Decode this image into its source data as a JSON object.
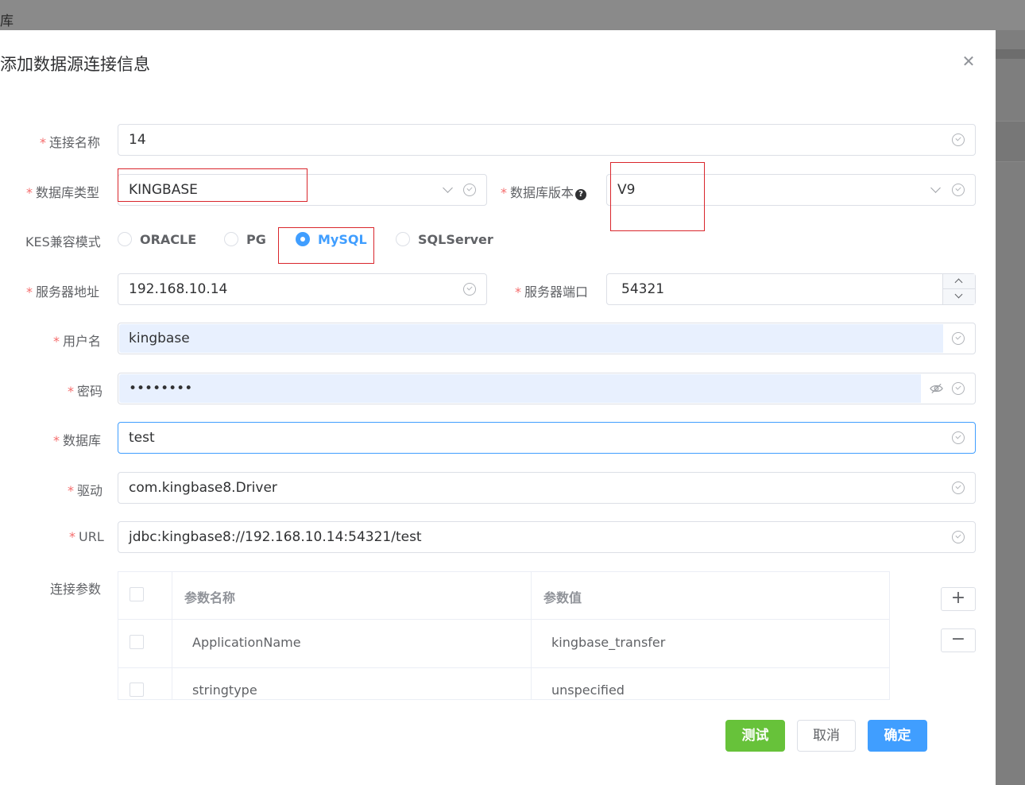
{
  "background": {
    "title": "库"
  },
  "dialog": {
    "title": "添加数据源连接信息",
    "close_icon": "close-icon"
  },
  "form": {
    "connection_name": {
      "label": "连接名称",
      "value": "14"
    },
    "db_type": {
      "label": "数据库类型",
      "value": "KINGBASE"
    },
    "db_version": {
      "label": "数据库版本",
      "value": "V9"
    },
    "kes_mode": {
      "label": "KES兼容模式",
      "options": [
        "ORACLE",
        "PG",
        "MySQL",
        "SQLServer"
      ],
      "selected": "MySQL"
    },
    "server_address": {
      "label": "服务器地址",
      "value": "192.168.10.14"
    },
    "server_port": {
      "label": "服务器端口",
      "value": "54321"
    },
    "username": {
      "label": "用户名",
      "value": "kingbase"
    },
    "password": {
      "label": "密码",
      "value": "••••••••"
    },
    "database": {
      "label": "数据库",
      "value": "test"
    },
    "driver": {
      "label": "驱动",
      "value": "com.kingbase8.Driver"
    },
    "url": {
      "label": "URL",
      "value": "jdbc:kingbase8://192.168.10.14:54321/test"
    },
    "params": {
      "label": "连接参数",
      "columns": [
        "参数名称",
        "参数值"
      ],
      "rows": [
        {
          "name": "ApplicationName",
          "value": "kingbase_transfer"
        },
        {
          "name": "stringtype",
          "value": "unspecified"
        }
      ],
      "add_label": "+",
      "remove_label": "−"
    }
  },
  "buttons": {
    "test": "测试",
    "cancel": "取消",
    "ok": "确定"
  },
  "colors": {
    "primary": "#409eff",
    "success": "#67c23a",
    "required": "#f56c6c",
    "highlight_box": "#d9262c",
    "autofill": "#e8f0fe"
  }
}
